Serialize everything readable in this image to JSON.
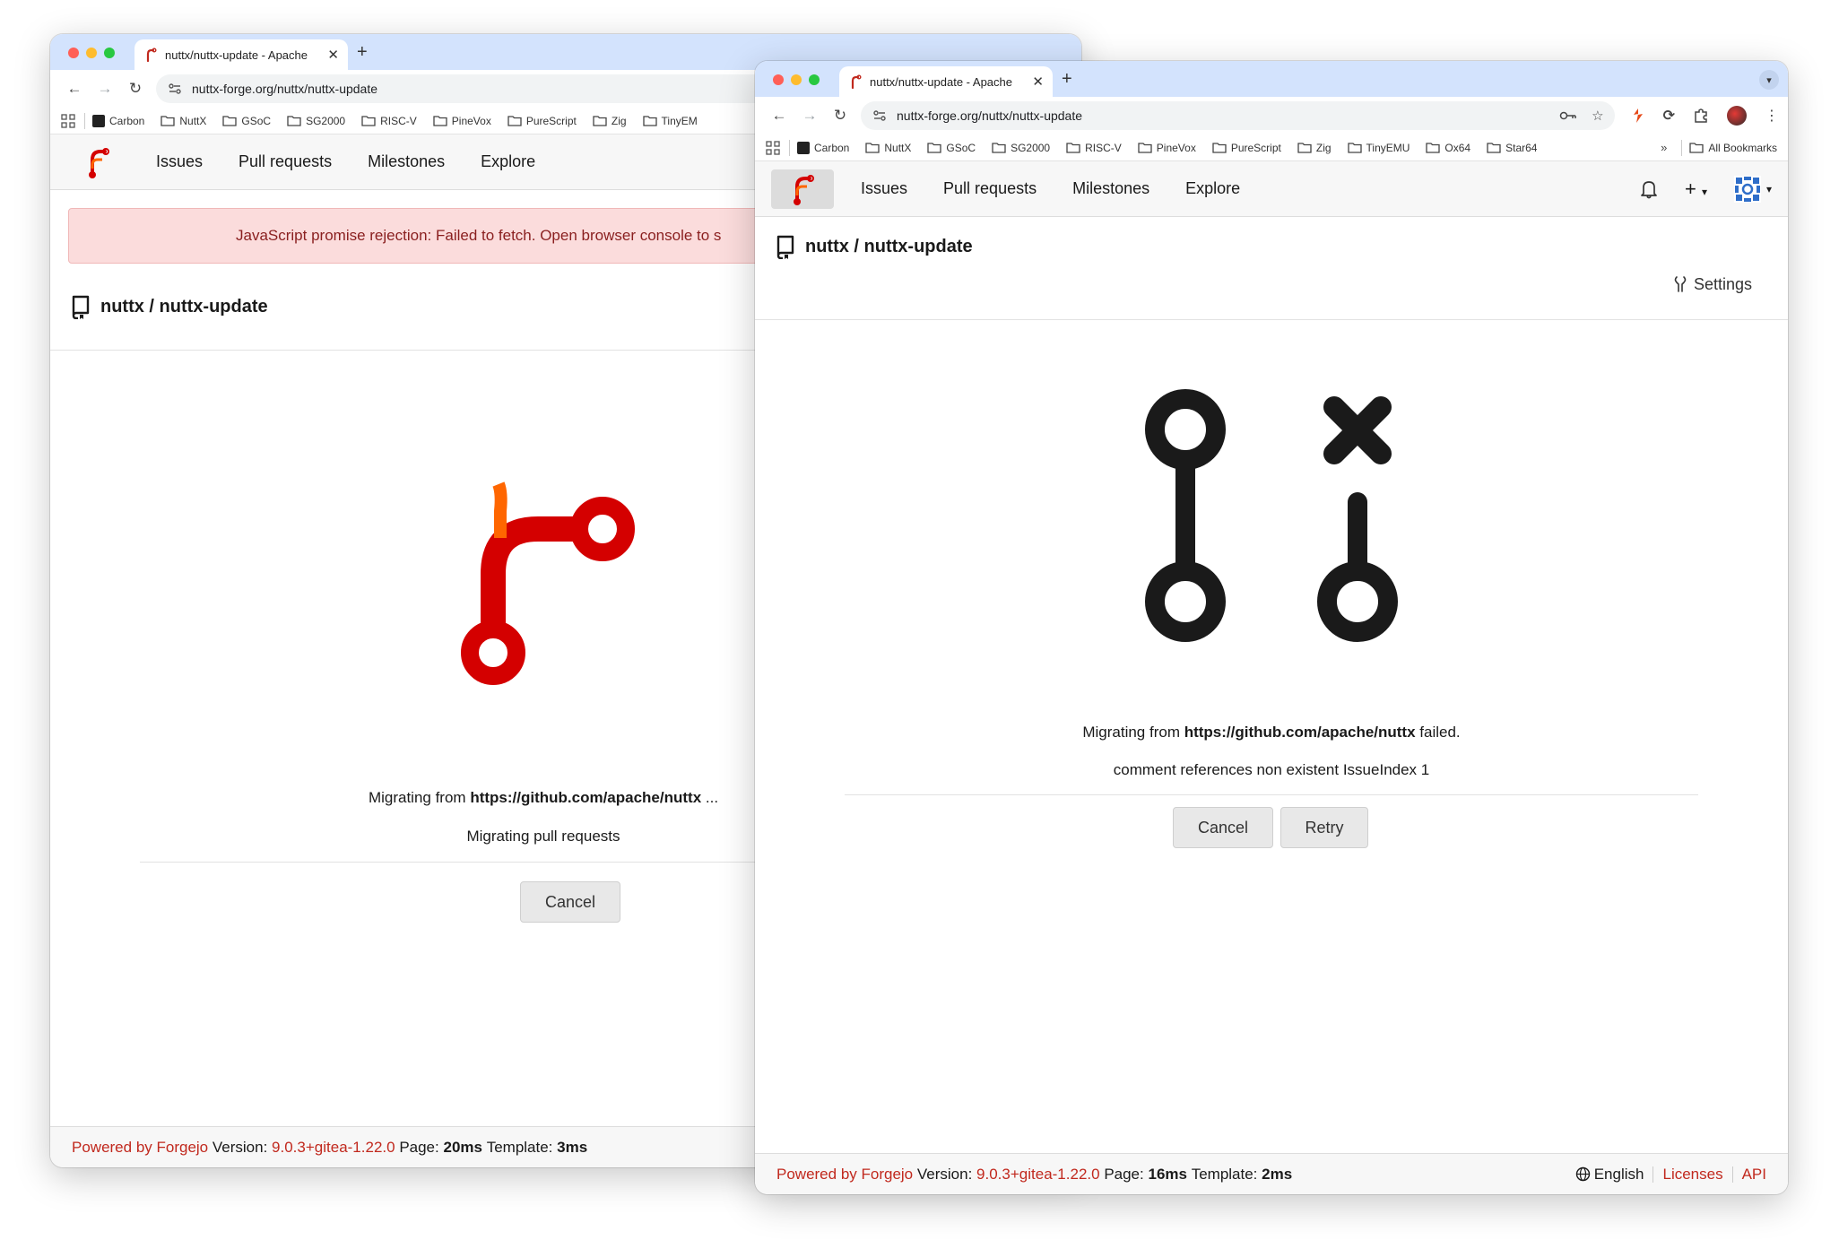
{
  "window_back": {
    "tab_title": "nuttx/nuttx-update - Apache",
    "url": "nuttx-forge.org/nuttx/nuttx-update",
    "bookmarks": [
      "Carbon",
      "NuttX",
      "GSoC",
      "SG2000",
      "RISC-V",
      "PineVox",
      "PureScript",
      "Zig",
      "TinyEM"
    ],
    "nav": [
      "Issues",
      "Pull requests",
      "Milestones",
      "Explore"
    ],
    "flash": "JavaScript promise rejection: Failed to fetch. Open browser console to s",
    "repo": "nuttx / nuttx-update",
    "migrating_prefix": "Migrating from ",
    "migrating_url": "https://github.com/apache/nuttx",
    "migrating_suffix": " ...",
    "status": "Migrating pull requests",
    "cancel": "Cancel",
    "footer": {
      "powered": "Powered by Forgejo",
      "version_label": "Version:",
      "version": "9.0.3+gitea-1.22.0",
      "page_label": "Page:",
      "page": "20ms",
      "template_label": "Template:",
      "template": "3ms"
    }
  },
  "window_front": {
    "tab_title": "nuttx/nuttx-update - Apache",
    "url": "nuttx-forge.org/nuttx/nuttx-update",
    "bookmarks": [
      "Carbon",
      "NuttX",
      "GSoC",
      "SG2000",
      "RISC-V",
      "PineVox",
      "PureScript",
      "Zig",
      "TinyEMU",
      "Ox64",
      "Star64"
    ],
    "bookmarks_more": "»",
    "all_bookmarks": "All Bookmarks",
    "nav": [
      "Issues",
      "Pull requests",
      "Milestones",
      "Explore"
    ],
    "repo": "nuttx / nuttx-update",
    "settings": "Settings",
    "failed_prefix": "Migrating from ",
    "failed_url": "https://github.com/apache/nuttx",
    "failed_suffix": " failed.",
    "error": "comment references non existent IssueIndex 1",
    "cancel": "Cancel",
    "retry": "Retry",
    "footer": {
      "powered": "Powered by Forgejo",
      "version_label": "Version:",
      "version": "9.0.3+gitea-1.22.0",
      "page_label": "Page:",
      "page": "16ms",
      "template_label": "Template:",
      "template": "2ms",
      "language": "English",
      "licenses": "Licenses",
      "api": "API"
    }
  },
  "colors": {
    "forgejo_red": "#c1291e",
    "forgejo_orange": "#ff6600",
    "tabstrip": "#d3e3fd",
    "flash_bg": "#fbdcdc"
  }
}
